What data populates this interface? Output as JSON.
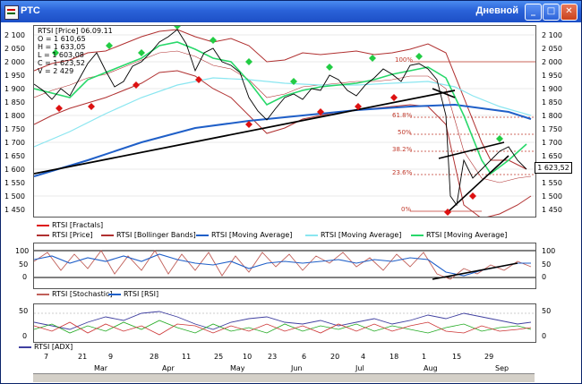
{
  "window": {
    "title": "РТС",
    "right_title": "Дневной",
    "btn_min": "_",
    "btn_max": "□",
    "btn_close": "✕"
  },
  "info": {
    "line1": "RTSI [Price] 06.09.11",
    "line2": "O = 1 610,65",
    "line3": "H = 1 633,05",
    "line4": "L = 1 603,08",
    "line5": "C = 1 623,52",
    "line6": "V = 2 429"
  },
  "price_axis": [
    "2 100",
    "2 050",
    "2 000",
    "1 950",
    "1 900",
    "1 850",
    "1 800",
    "1 750",
    "1 700",
    "1 650",
    "1 600",
    "1 550",
    "1 500",
    "1 450"
  ],
  "price_box": "1 623,52",
  "fib": {
    "f100": "100%",
    "f618": "61.8%",
    "f50": "50%",
    "f382": "38.2%",
    "f236": "23.6%",
    "f0": "0%"
  },
  "legend_main": {
    "l1": "RTSI [Fractals]",
    "l2": "RTSI [Price]",
    "l3": "RTSI [Bollinger Bands]",
    "l4": "RTSI [Moving Average]",
    "l5": "RTSI [Moving Average]",
    "l6": "RTSI [Moving Average]"
  },
  "osc_axis": [
    "100",
    "50",
    "0"
  ],
  "legend_osc": {
    "l1": "RTSI [Stochastic]",
    "l2": "RTSI [RSI]"
  },
  "adx_axis": [
    "50",
    "0"
  ],
  "legend_adx": {
    "l1": "RTSI [ADX]"
  },
  "xticks": [
    "7",
    "21",
    "9",
    "28",
    "11",
    "25",
    "10",
    "23",
    "6",
    "20",
    "4",
    "18",
    "1",
    "15",
    "29"
  ],
  "months": [
    "Mar",
    "Apr",
    "May",
    "Jun",
    "Jul",
    "Aug",
    "Sep"
  ],
  "colors": {
    "bollinger": "#b03030",
    "ma_blue": "#1f5fc8",
    "ma_cyan": "#8ae6f0",
    "ma_green": "#28d86a",
    "fractal_up": "#22cc44",
    "fractal_down": "#dd1111"
  }
}
